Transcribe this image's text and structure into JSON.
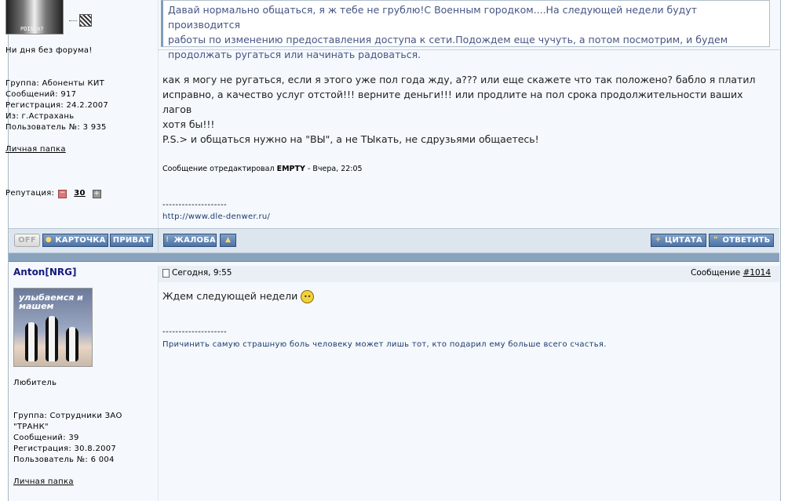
{
  "post1": {
    "avatar_caption": "PDIS.n?",
    "user_title": "Ни дня без форума!",
    "group": "Группа: Абоненты КИТ",
    "messages": "Сообщений: 917",
    "registered": "Регистрация: 24.2.2007",
    "location": "Из: г.Астрахань",
    "user_number": "Пользователь №: 3 935",
    "personal_folder": "Личная папка",
    "reputation_label": "Репутация:",
    "reputation_value": "30",
    "quote_lines": [
      "Давай нормально общаться, я ж тебе не грублю!С Военным городком....На следующей недели будут производится",
      "работы по изменению предоставления доступа к сети.Подождем еще чучуть, а потом посмотрим, и будем",
      "продолжать ругаться или начинать радоваться."
    ],
    "body_lines": [
      "как я могу не ругаться, если я этого уже пол года жду, а??? или еще скажете что так положено? бабло я платил",
      "исправно, а качество услуг отстой!!! верните деньги!!! или продлите на пол срока продолжительности ваших лагов",
      "хотя бы!!!"
    ],
    "ps_line": "P.S.> и общаться нужно на \"ВЫ\", а не ТЫкать, не сдрузьями общаетесь!",
    "edited_prefix": "Сообщение отредактировал",
    "edited_user": "EMPTY",
    "edited_suffix": "- Вчера, 22:05",
    "sig_dashes": "--------------------",
    "signature": "http://www.dle-denwer.ru/"
  },
  "buttons": {
    "off": "OFF",
    "card": "КАРТОЧКА",
    "private": "ПРИВАТ",
    "complaint": "ЖАЛОБА",
    "quote": "ЦИТАТА",
    "reply": "ОТВЕТИТЬ"
  },
  "post2": {
    "username": "Anton[NRG]",
    "date": "Сегодня, 9:55",
    "message_label": "Сообщение",
    "message_number": "#1014",
    "avatar_caption": "улыбаемся и машем",
    "user_title": "Любитель",
    "group_line1": "Группа: Сотрудники ЗАО",
    "group_line2": "\"ТРАНК\"",
    "messages": "Сообщений: 39",
    "registered": "Регистрация: 30.8.2007",
    "user_number": "Пользователь №: 6 004",
    "personal_folder": "Личная папка",
    "body": "Ждем следующей недели",
    "sig_dashes": "--------------------",
    "signature": "Причинить самую страшную боль человеку может лишь тот, кто подарил ему больше всего счастья."
  },
  "colors": {
    "accent": "#4d73a6",
    "separator": "#8aa3bd",
    "quote_text": "#465584",
    "username": "#15197e"
  }
}
